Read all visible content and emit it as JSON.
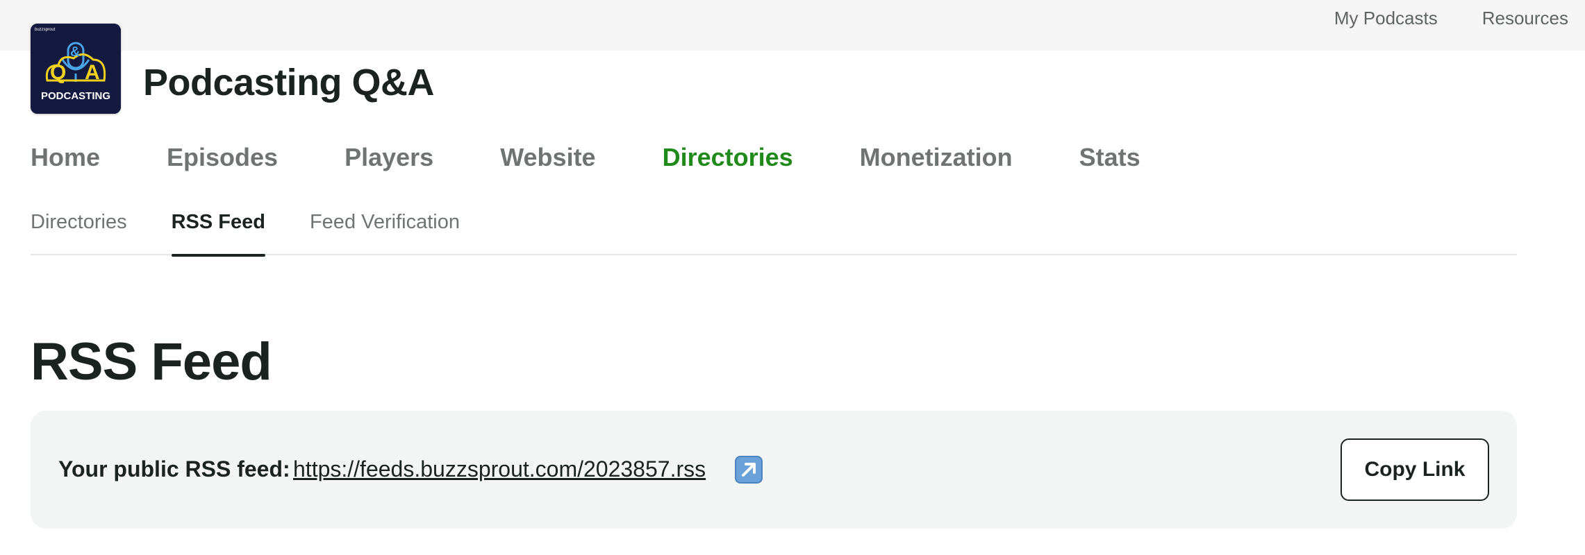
{
  "top_nav": {
    "items": [
      {
        "label": "My Podcasts"
      },
      {
        "label": "Resources"
      }
    ]
  },
  "podcast": {
    "title": "Podcasting Q&A",
    "logo": {
      "tag": "buzzsprout",
      "letters": [
        "Q",
        "&",
        "A"
      ],
      "caption": "PODCASTING",
      "colors": {
        "background": "#14193f",
        "gold": "#f3d21d",
        "blue": "#4aa4e6"
      }
    }
  },
  "main_nav": {
    "items": [
      {
        "label": "Home"
      },
      {
        "label": "Episodes"
      },
      {
        "label": "Players"
      },
      {
        "label": "Website"
      },
      {
        "label": "Directories",
        "active": true
      },
      {
        "label": "Monetization"
      },
      {
        "label": "Stats"
      }
    ]
  },
  "sub_nav": {
    "items": [
      {
        "label": "Directories"
      },
      {
        "label": "RSS Feed",
        "active": true
      },
      {
        "label": "Feed Verification"
      }
    ]
  },
  "page": {
    "heading": "RSS Feed",
    "feed": {
      "label": "Your public RSS feed:",
      "url": "https://feeds.buzzsprout.com/2023857.rss",
      "open_icon": "external-link-arrow-icon",
      "copy_label": "Copy Link"
    }
  },
  "colors": {
    "accent_green": "#1f8a1a",
    "text_dark": "#1b2321",
    "nav_gray": "#6f7472",
    "topbar_bg": "#f5f5f5",
    "panel_bg": "#f3f4f4"
  }
}
